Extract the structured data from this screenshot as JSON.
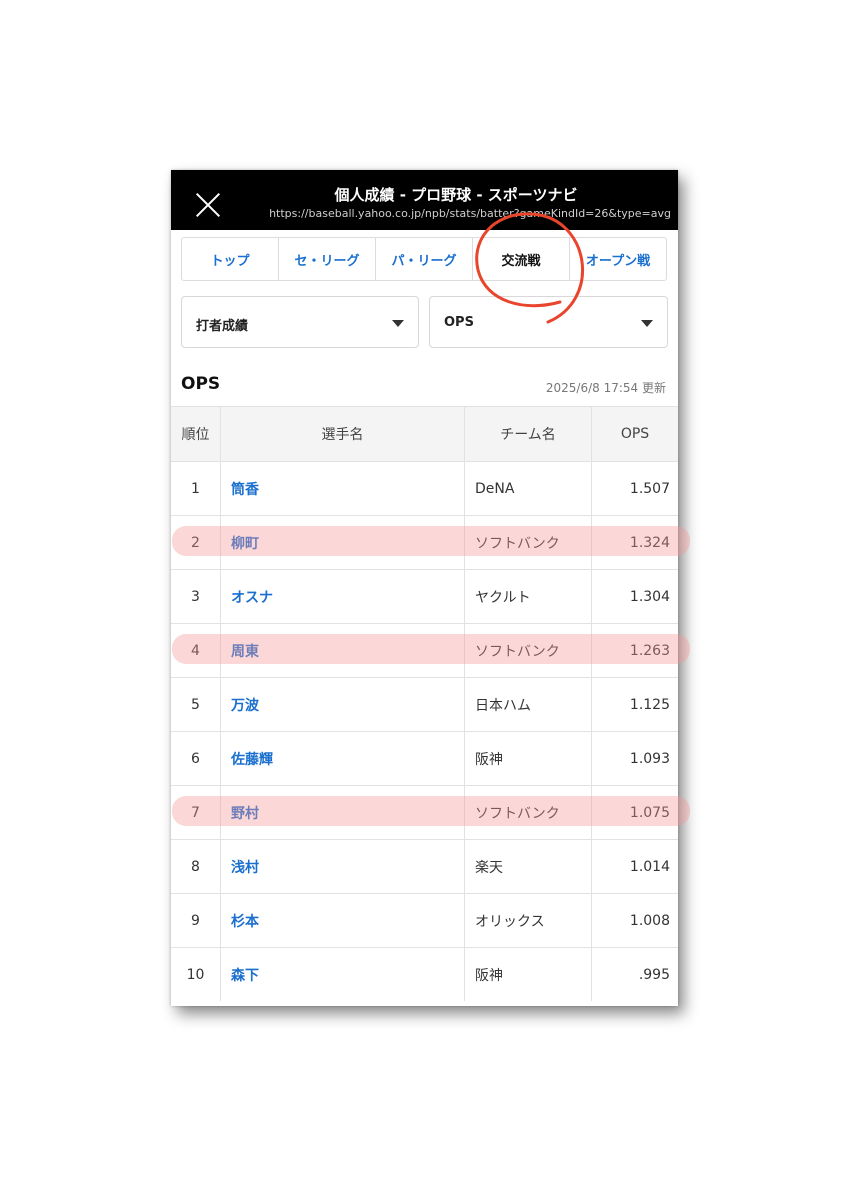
{
  "header": {
    "title": "個人成績 - プロ野球 - スポーツナビ",
    "url": "https://baseball.yahoo.co.jp/npb/stats/batter?gameKindId=26&type=avg"
  },
  "tabs": [
    {
      "label": "トップ"
    },
    {
      "label": "セ・リーグ"
    },
    {
      "label": "パ・リーグ"
    },
    {
      "label": "交流戦",
      "active": true
    },
    {
      "label": "オープン戦"
    }
  ],
  "filters": {
    "category": "打者成績",
    "stat": "OPS"
  },
  "section": {
    "title": "OPS",
    "updated": "2025/6/8 17:54 更新"
  },
  "table": {
    "headers": {
      "rank": "順位",
      "name": "選手名",
      "team": "チーム名",
      "ops": "OPS"
    },
    "rows": [
      {
        "rank": "1",
        "name": "筒香",
        "team": "DeNA",
        "ops": "1.507"
      },
      {
        "rank": "2",
        "name": "柳町",
        "team": "ソフトバンク",
        "ops": "1.324"
      },
      {
        "rank": "3",
        "name": "オスナ",
        "team": "ヤクルト",
        "ops": "1.304"
      },
      {
        "rank": "4",
        "name": "周東",
        "team": "ソフトバンク",
        "ops": "1.263"
      },
      {
        "rank": "5",
        "name": "万波",
        "team": "日本ハム",
        "ops": "1.125"
      },
      {
        "rank": "6",
        "name": "佐藤輝",
        "team": "阪神",
        "ops": "1.093"
      },
      {
        "rank": "7",
        "name": "野村",
        "team": "ソフトバンク",
        "ops": "1.075"
      },
      {
        "rank": "8",
        "name": "浅村",
        "team": "楽天",
        "ops": "1.014"
      },
      {
        "rank": "9",
        "name": "杉本",
        "team": "オリックス",
        "ops": "1.008"
      },
      {
        "rank": "10",
        "name": "森下",
        "team": "阪神",
        "ops": ".995"
      }
    ]
  },
  "colors": {
    "link": "#1a6fcf",
    "highlight": "#f59696",
    "circle": "#e8452c"
  }
}
